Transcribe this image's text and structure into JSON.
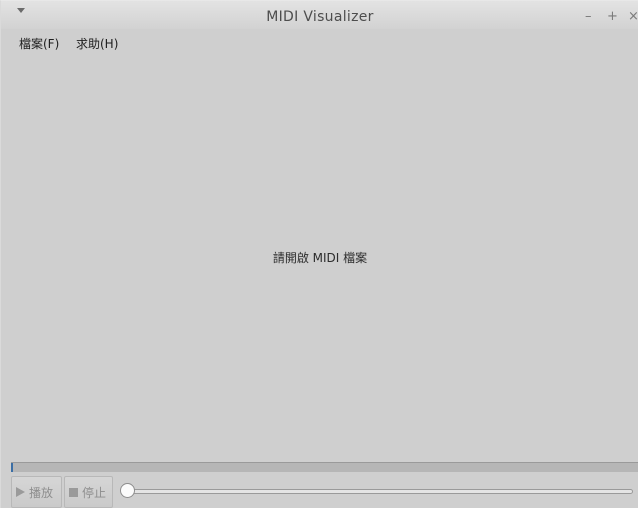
{
  "window": {
    "title": "MIDI Visualizer",
    "controls": {
      "minimize": "–",
      "maximize": "+",
      "close": "×"
    }
  },
  "menubar": {
    "items": [
      {
        "label": "檔案(F)"
      },
      {
        "label": "求助(H)"
      }
    ]
  },
  "content": {
    "placeholder": "請開啟 MIDI 檔案"
  },
  "playback": {
    "progress_fraction": 0.003,
    "play_label": "播放",
    "stop_label": "停止",
    "seek_fraction": 0
  },
  "colors": {
    "window_bg": "#cfcfcf",
    "progress_fill": "#3b6ea5",
    "disabled_text": "#8e8e8e"
  },
  "icons": [
    "menu-arrow-icon",
    "minimize-icon",
    "maximize-icon",
    "close-icon",
    "play-icon",
    "stop-icon"
  ]
}
